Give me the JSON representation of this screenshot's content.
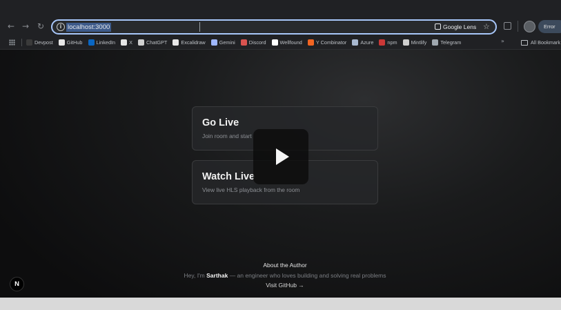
{
  "browser": {
    "url": "localhost:3000",
    "lens_label": "Google Lens",
    "error_label": "Error"
  },
  "bookmarks": {
    "items": [
      {
        "label": "Devpost",
        "color": "#3a3a3a"
      },
      {
        "label": "GitHub",
        "color": "#e6e6e6"
      },
      {
        "label": "LinkedIn",
        "color": "#0a66c2"
      },
      {
        "label": "X",
        "color": "#e6e6e6"
      },
      {
        "label": "ChatGPT",
        "color": "#d0d0d0"
      },
      {
        "label": "Excalidraw",
        "color": "#e8e8e8"
      },
      {
        "label": "Gemini",
        "color": "#9fb7ff"
      },
      {
        "label": "Discord",
        "color": "#d9534f"
      },
      {
        "label": "Wellfound",
        "color": "#ffffff"
      },
      {
        "label": "Y Combinator",
        "color": "#f26522"
      },
      {
        "label": "Azure",
        "color": "#a8b8d0"
      },
      {
        "label": "npm",
        "color": "#cb3837"
      },
      {
        "label": "Mintlify",
        "color": "#cfcfcf"
      },
      {
        "label": "Telegram",
        "color": "#a0a8b0"
      }
    ],
    "more": "»",
    "all_bookmarks": "All Bookmark"
  },
  "main": {
    "cards": [
      {
        "title": "Go Live",
        "description": "Join room and start"
      },
      {
        "title": "Watch Live",
        "description": "View live HLS playback from the room"
      }
    ]
  },
  "footer": {
    "heading": "About the Author",
    "intro": "Hey, I'm",
    "name": "Sarthak",
    "tagline": " — an engineer who loves building and solving real problems",
    "link": "Visit GitHub →"
  },
  "next_badge": "N"
}
